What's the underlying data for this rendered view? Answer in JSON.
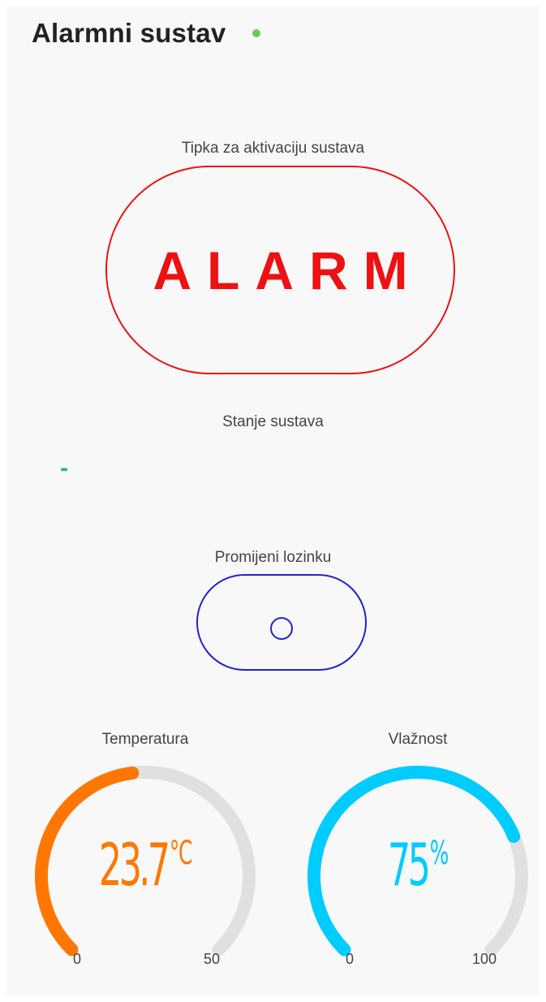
{
  "app": {
    "title": "Alarmni sustav",
    "online_color": "#66cc55"
  },
  "alarm_section": {
    "label": "Tipka za aktivaciju sustava",
    "button_text": "ALARM",
    "color": "#ee1111"
  },
  "state_section": {
    "label": "Stanje sustava",
    "value": "-",
    "color": "#22bb88"
  },
  "password_section": {
    "label": "Promijeni lozinku",
    "color": "#2222cc"
  },
  "gauges": {
    "temperature": {
      "label": "Temperatura",
      "value": "23.7",
      "unit": "°C",
      "min": "0",
      "max": "50",
      "fraction": 0.474,
      "color": "#ff7700",
      "track_color": "#e0e0e0"
    },
    "humidity": {
      "label": "Vlažnost",
      "value": "75",
      "unit": "%",
      "min": "0",
      "max": "100",
      "fraction": 0.75,
      "color": "#00ccff",
      "track_color": "#e0e0e0"
    }
  }
}
